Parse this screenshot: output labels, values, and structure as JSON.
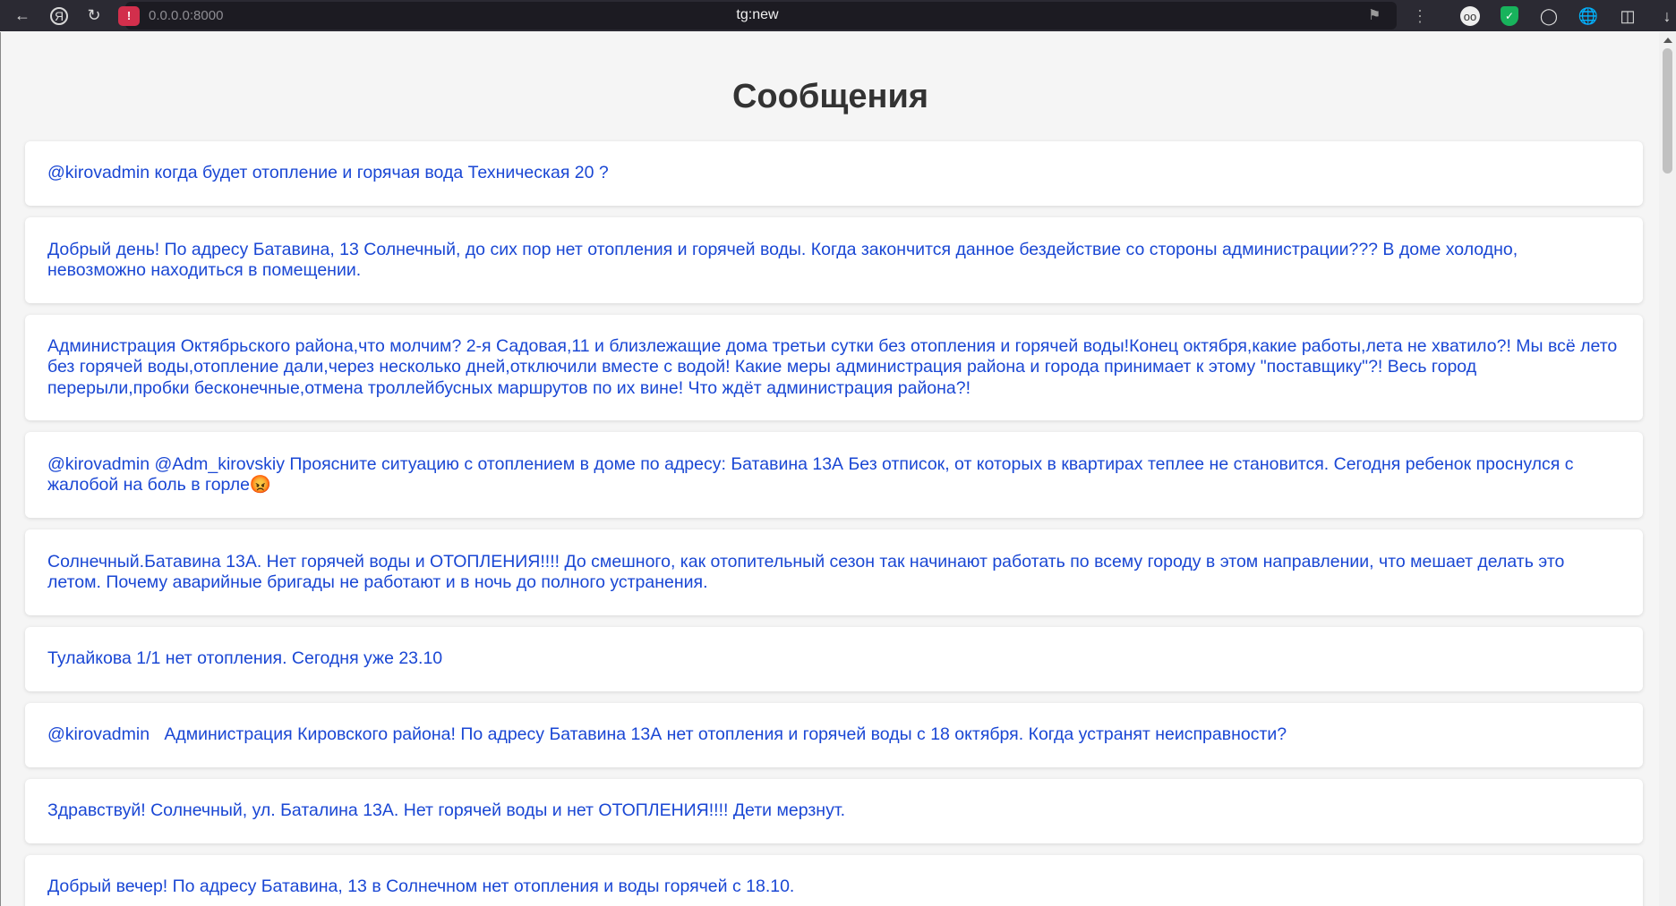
{
  "browser": {
    "url": "0.0.0.0:8000",
    "tab_title": "tg:new",
    "icons": [
      "back-icon",
      "yandex-icon",
      "reload-icon",
      "warning-icon",
      "bookmark-icon",
      "menu-icon",
      "privacy-ext-icon",
      "adblock-shield-icon",
      "ext-icon",
      "globe-icon",
      "bookmarks-panel-icon",
      "download-icon"
    ]
  },
  "page": {
    "title": "Сообщения"
  },
  "messages": [
    {
      "text": "@kirovadmin когда будет отопление и горячая вода Техническая 20 ?"
    },
    {
      "text": "Добрый день! По адресу Батавина, 13 Солнечный, до сих пор нет отопления и горячей воды. Когда закончится данное бездействие со стороны администрации??? В доме холодно, невозможно находиться в помещении."
    },
    {
      "text": "Администрация Октябрьского района,что молчим? 2-я Садовая,11 и близлежащие дома третьи сутки без отопления и горячей воды!Конец октября,какие работы,лета не хватило?! Мы всё лето без горячей воды,отопление дали,через несколько дней,отключили вместе с водой! Какие меры администрация района и города принимает к этому \"поставщику\"?! Весь город перерыли,пробки бесконечные,отмена троллейбусных маршрутов по их вине! Что ждёт администрация района?!"
    },
    {
      "text": "@kirovadmin @Adm_kirovskiy Проясните ситуацию с отоплением в доме по адресу: Батавина 13А Без отписок, от которых в квартирах теплее не становится. Сегодня ребенок проснулся с жалобой на боль в горле😡"
    },
    {
      "text": "Солнечный.Батавина 13А. Нет горячей воды и ОТОПЛЕНИЯ!!!! До смешного, как отопительный сезон так начинают работать по всему городу в этом направлении, что мешает делать это летом. Почему аварийные бригады не работают и в ночь до полного устранения."
    },
    {
      "text": "Тулайкова 1/1 нет отопления. Сегодня уже 23.10"
    },
    {
      "text": "@kirovadmin   Администрация Кировского района! По адресу Батавина 13А нет отопления и горячей воды с 18 октября. Когда устранят неисправности?"
    },
    {
      "text": "Здравствуй! Солнечный, ул. Баталина 13А. Нет горячей воды и нет ОТОПЛЕНИЯ!!!! Дети мерзнут."
    },
    {
      "text": "Добрый вечер! По адресу Батавина, 13 в Солнечном нет отопления и воды горячей с 18.10."
    }
  ],
  "colors": {
    "message_text": "#1a47d4",
    "page_bg": "#f5f5f5",
    "card_bg": "#ffffff",
    "title": "#333333"
  }
}
